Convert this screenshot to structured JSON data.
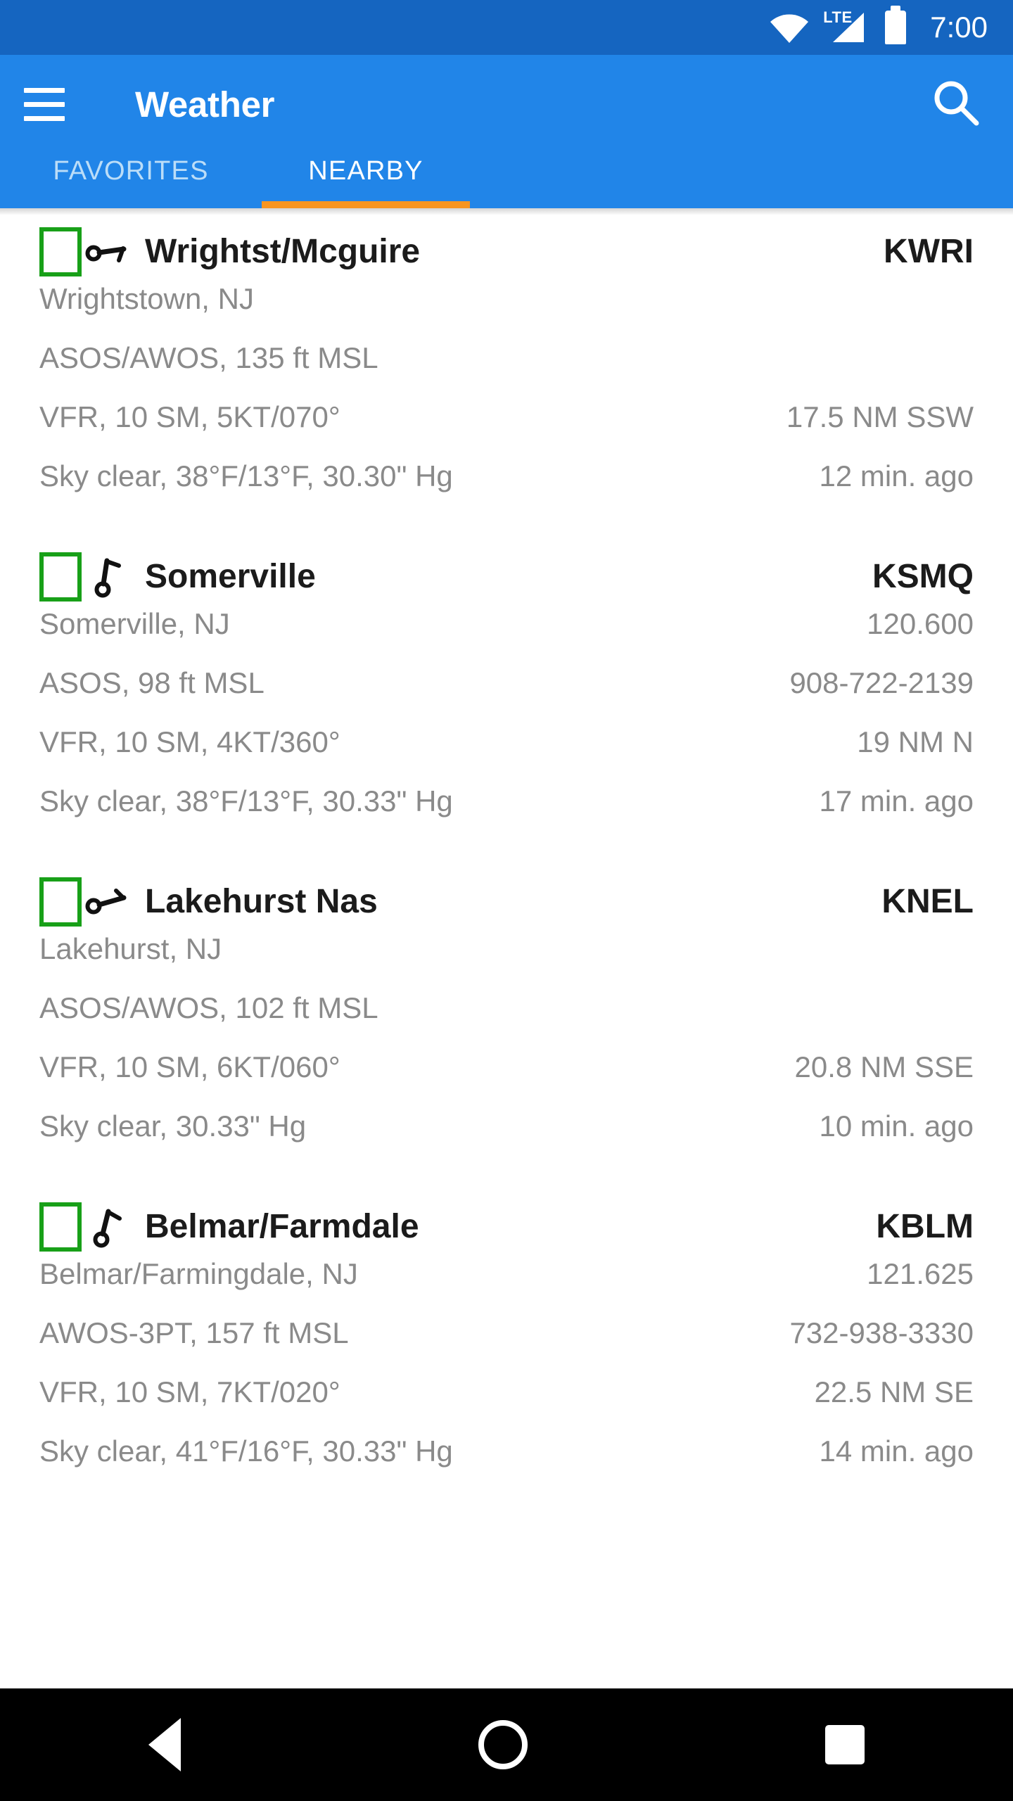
{
  "status_bar": {
    "wifi_icon": "wifi-icon",
    "network_label": "LTE",
    "signal_icon": "cell-signal-icon",
    "battery_icon": "battery-full-icon",
    "time": "7:00"
  },
  "toolbar": {
    "menu_icon": "hamburger-menu-icon",
    "title": "Weather",
    "search_icon": "search-icon",
    "accent_color": "#2185E8",
    "status_color": "#1565C0",
    "indicator_color": "#F79521"
  },
  "tabs": [
    {
      "label": "FAVORITES",
      "active": false
    },
    {
      "label": "NEARBY",
      "active": true
    }
  ],
  "list": {
    "checkbox_color": "#18A018",
    "stations": [
      {
        "name": "Wrightst/Mcguire",
        "ident": "KWRI",
        "runway_icon": "runway-horizontal-icon",
        "checked": false,
        "city": "Wrightstown, NJ",
        "frequency": "",
        "equipment": "ASOS/AWOS, 135 ft MSL",
        "phone": "",
        "conditions": "VFR, 10 SM, 5KT/070°",
        "distance": "17.5 NM SSW",
        "sky": "Sky clear, 38°F/13°F, 30.30\" Hg",
        "updated": "12 min. ago"
      },
      {
        "name": "Somerville",
        "ident": "KSMQ",
        "runway_icon": "runway-vertical-icon",
        "checked": false,
        "city": "Somerville, NJ",
        "frequency": "120.600",
        "equipment": "ASOS, 98 ft MSL",
        "phone": "908-722-2139",
        "conditions": "VFR, 10 SM, 4KT/360°",
        "distance": "19 NM N",
        "sky": "Sky clear, 38°F/13°F, 30.33\" Hg",
        "updated": "17 min. ago"
      },
      {
        "name": "Lakehurst Nas",
        "ident": "KNEL",
        "runway_icon": "runway-horizontal-icon",
        "checked": false,
        "city": "Lakehurst, NJ",
        "frequency": "",
        "equipment": "ASOS/AWOS, 102 ft MSL",
        "phone": "",
        "conditions": "VFR, 10 SM, 6KT/060°",
        "distance": "20.8 NM SSE",
        "sky": "Sky clear, 30.33\" Hg",
        "updated": "10 min. ago"
      },
      {
        "name": "Belmar/Farmdale",
        "ident": "KBLM",
        "runway_icon": "runway-vertical-icon",
        "checked": false,
        "city": "Belmar/Farmingdale, NJ",
        "frequency": "121.625",
        "equipment": "AWOS-3PT, 157 ft MSL",
        "phone": "732-938-3330",
        "conditions": "VFR, 10 SM, 7KT/020°",
        "distance": "22.5 NM SE",
        "sky": "Sky clear, 41°F/16°F, 30.33\" Hg",
        "updated": "14 min. ago"
      }
    ]
  },
  "navbar": {
    "back_icon": "back-triangle-icon",
    "home_icon": "home-circle-icon",
    "recents_icon": "recents-square-icon"
  }
}
